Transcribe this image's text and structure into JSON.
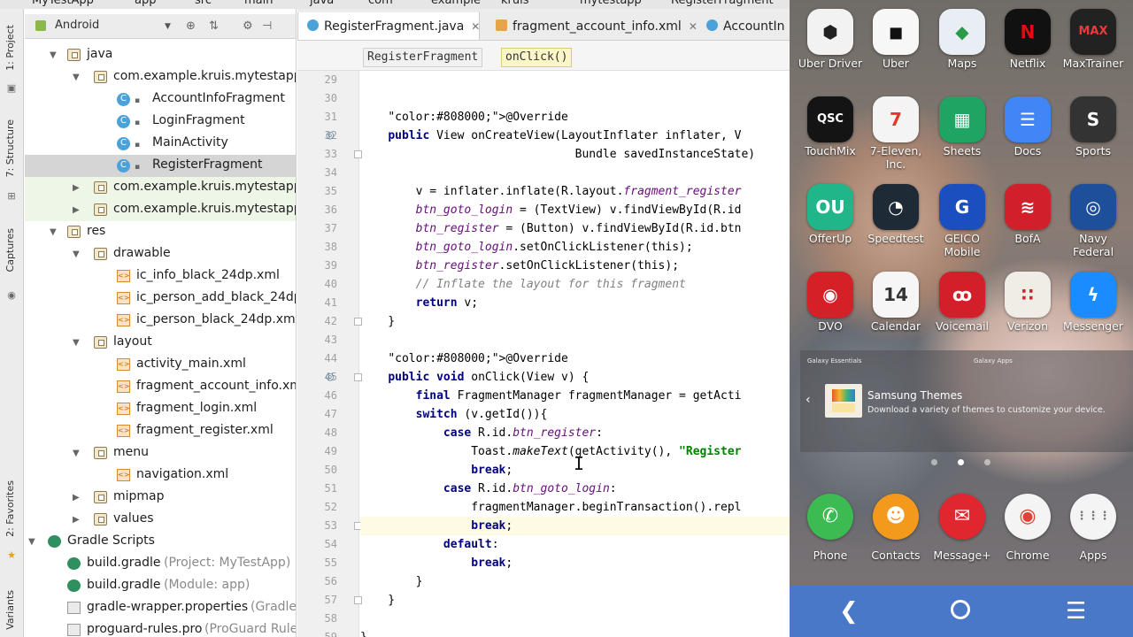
{
  "breadcrumb": [
    "MyTestApp",
    "app",
    "src",
    "main",
    "java",
    "com",
    "example",
    "kruis",
    "mytestapp",
    "RegisterFragment"
  ],
  "tool_strip": {
    "project": "1: Project",
    "structure": "7: Structure",
    "captures": "Captures",
    "favorites": "2: Favorites",
    "variants": "Variants"
  },
  "project_panel": {
    "view_mode": "Android",
    "tree": [
      {
        "label": "java",
        "icon": "folder"
      },
      {
        "label": "com.example.kruis.mytestapp",
        "icon": "package"
      },
      {
        "label": "AccountInfoFragment",
        "icon": "class"
      },
      {
        "label": "LoginFragment",
        "icon": "class"
      },
      {
        "label": "MainActivity",
        "icon": "class"
      },
      {
        "label": "RegisterFragment",
        "icon": "class"
      },
      {
        "label": "com.example.kruis.mytestapp",
        "icon": "package",
        "suffix": "("
      },
      {
        "label": "com.example.kruis.mytestapp",
        "icon": "package",
        "suffix": "(test)"
      },
      {
        "label": "res",
        "icon": "folder"
      },
      {
        "label": "drawable",
        "icon": "folder"
      },
      {
        "label": "ic_info_black_24dp.xml",
        "icon": "xml"
      },
      {
        "label": "ic_person_add_black_24dp.x",
        "icon": "xml"
      },
      {
        "label": "ic_person_black_24dp.xml",
        "icon": "xml"
      },
      {
        "label": "layout",
        "icon": "folder"
      },
      {
        "label": "activity_main.xml",
        "icon": "xml"
      },
      {
        "label": "fragment_account_info.xml",
        "icon": "xml"
      },
      {
        "label": "fragment_login.xml",
        "icon": "xml"
      },
      {
        "label": "fragment_register.xml",
        "icon": "xml"
      },
      {
        "label": "menu",
        "icon": "folder"
      },
      {
        "label": "navigation.xml",
        "icon": "xml"
      },
      {
        "label": "mipmap",
        "icon": "folder"
      },
      {
        "label": "values",
        "icon": "folder"
      },
      {
        "label": "Gradle Scripts",
        "icon": "gradle"
      },
      {
        "label": "build.gradle",
        "icon": "gradle",
        "suffix": "(Project: MyTestApp)"
      },
      {
        "label": "build.gradle",
        "icon": "gradle",
        "suffix": "(Module: app)"
      },
      {
        "label": "gradle-wrapper.properties",
        "icon": "file",
        "suffix": "(Gradle V"
      },
      {
        "label": "proguard-rules.pro",
        "icon": "file",
        "suffix": "(ProGuard Rule"
      }
    ]
  },
  "editor": {
    "tabs": [
      {
        "label": "RegisterFragment.java",
        "active": true
      },
      {
        "label": "fragment_account_info.xml",
        "active": false
      },
      {
        "label": "AccountIn",
        "active": false
      }
    ],
    "breadcrumbs": [
      "RegisterFragment",
      "onClick()"
    ],
    "lines": [
      {
        "n": "29",
        "t": ""
      },
      {
        "n": "30",
        "t": ""
      },
      {
        "n": "31",
        "t": "    @Override"
      },
      {
        "n": "32",
        "t": "    public View onCreateView(LayoutInflater inflater, V"
      },
      {
        "n": "33",
        "t": "                               Bundle savedInstanceState)"
      },
      {
        "n": "34",
        "t": ""
      },
      {
        "n": "35",
        "t": "        v = inflater.inflate(R.layout.fragment_register"
      },
      {
        "n": "36",
        "t": "        btn_goto_login = (TextView) v.findViewById(R.id"
      },
      {
        "n": "37",
        "t": "        btn_register = (Button) v.findViewById(R.id.btn"
      },
      {
        "n": "38",
        "t": "        btn_goto_login.setOnClickListener(this);"
      },
      {
        "n": "39",
        "t": "        btn_register.setOnClickListener(this);"
      },
      {
        "n": "40",
        "t": "        // Inflate the layout for this fragment"
      },
      {
        "n": "41",
        "t": "        return v;"
      },
      {
        "n": "42",
        "t": "    }"
      },
      {
        "n": "43",
        "t": ""
      },
      {
        "n": "44",
        "t": "    @Override"
      },
      {
        "n": "45",
        "t": "    public void onClick(View v) {"
      },
      {
        "n": "46",
        "t": "        final FragmentManager fragmentManager = getActi"
      },
      {
        "n": "47",
        "t": "        switch (v.getId()){"
      },
      {
        "n": "48",
        "t": "            case R.id.btn_register:"
      },
      {
        "n": "49",
        "t": "                Toast.makeText(getActivity(), \"Register"
      },
      {
        "n": "50",
        "t": "                break;"
      },
      {
        "n": "51",
        "t": "            case R.id.btn_goto_login:"
      },
      {
        "n": "52",
        "t": "                fragmentManager.beginTransaction().repl"
      },
      {
        "n": "53",
        "t": "                break;"
      },
      {
        "n": "54",
        "t": "            default:"
      },
      {
        "n": "55",
        "t": "                break;"
      },
      {
        "n": "56",
        "t": "        }"
      },
      {
        "n": "57",
        "t": "    }"
      },
      {
        "n": "58",
        "t": ""
      },
      {
        "n": "59",
        "t": "}"
      }
    ],
    "current_line": "53"
  },
  "phone": {
    "apps": [
      {
        "label": "Uber Driver",
        "icon": "uber-driver-icon",
        "bg": "#f2f2f2",
        "fg": "#222222",
        "glyph": "⬢"
      },
      {
        "label": "Uber",
        "icon": "uber-icon",
        "bg": "#f7f7f7",
        "fg": "#111111",
        "glyph": "◼"
      },
      {
        "label": "Maps",
        "icon": "maps-icon",
        "bg": "#e8eef4",
        "fg": "#2b9a4a",
        "glyph": "◆"
      },
      {
        "label": "Netflix",
        "icon": "netflix-icon",
        "bg": "#111111",
        "fg": "#e50914",
        "glyph": "N"
      },
      {
        "label": "MaxTrainer",
        "icon": "maxtrainer-icon",
        "bg": "#222222",
        "fg": "#e83b3b",
        "glyph": "MAX"
      },
      {
        "label": "TouchMix",
        "icon": "touchmix-icon",
        "bg": "#141414",
        "fg": "#ffffff",
        "glyph": "QSC"
      },
      {
        "label": "7-Eleven,\nInc.",
        "icon": "seven-eleven-icon",
        "bg": "#f4f4f4",
        "fg": "#e2372b",
        "glyph": "7"
      },
      {
        "label": "Sheets",
        "icon": "sheets-icon",
        "bg": "#1fa463",
        "fg": "#ffffff",
        "glyph": "▦"
      },
      {
        "label": "Docs",
        "icon": "docs-icon",
        "bg": "#4285f4",
        "fg": "#ffffff",
        "glyph": "☰"
      },
      {
        "label": "Sports",
        "icon": "sports-icon",
        "bg": "#333333",
        "fg": "#ffffff",
        "glyph": "S"
      },
      {
        "label": "OfferUp",
        "icon": "offerup-icon",
        "bg": "#20b68a",
        "fg": "#ffffff",
        "glyph": "OU"
      },
      {
        "label": "Speedtest",
        "icon": "speedtest-icon",
        "bg": "#1e2a36",
        "fg": "#ffffff",
        "glyph": "◔"
      },
      {
        "label": "GEICO\nMobile",
        "icon": "geico-icon",
        "bg": "#1b4fc0",
        "fg": "#ffffff",
        "glyph": "G"
      },
      {
        "label": "BofA",
        "icon": "bofa-icon",
        "bg": "#d11f2b",
        "fg": "#ffffff",
        "glyph": "≋"
      },
      {
        "label": "Navy\nFederal",
        "icon": "navy-federal-icon",
        "bg": "#1d4f9a",
        "fg": "#ffffff",
        "glyph": "◎"
      },
      {
        "label": "DVO",
        "icon": "dvo-icon",
        "bg": "#d62027",
        "fg": "#ffffff",
        "glyph": "◉"
      },
      {
        "label": "Calendar",
        "icon": "calendar-icon",
        "bg": "#f6f6f6",
        "fg": "#333333",
        "glyph": "14"
      },
      {
        "label": "Voicemail",
        "icon": "voicemail-icon",
        "bg": "#d31f2a",
        "fg": "#ffffff",
        "glyph": "ꝏ"
      },
      {
        "label": "Verizon",
        "icon": "verizon-icon",
        "bg": "#f0ece6",
        "fg": "#d0232e",
        "glyph": "∷"
      },
      {
        "label": "Messenger",
        "icon": "messenger-icon",
        "bg": "#1a8cff",
        "fg": "#ffffff",
        "glyph": "ϟ"
      }
    ],
    "dock": [
      {
        "label": "Phone",
        "icon": "phone-icon",
        "bg": "#3dbb53",
        "fg": "#ffffff",
        "glyph": "✆"
      },
      {
        "label": "Contacts",
        "icon": "contacts-icon",
        "bg": "#f39a1c",
        "fg": "#ffffff",
        "glyph": "☻"
      },
      {
        "label": "Message+",
        "icon": "message-plus-icon",
        "bg": "#e0262e",
        "fg": "#ffffff",
        "glyph": "✉"
      },
      {
        "label": "Chrome",
        "icon": "chrome-icon",
        "bg": "#f4f4f4",
        "fg": "#db4437",
        "glyph": "◉"
      },
      {
        "label": "Apps",
        "icon": "apps-icon",
        "bg": "#f4f4f4",
        "fg": "#777777",
        "glyph": "⋮⋮⋮"
      }
    ],
    "widget": {
      "tag_left": "Galaxy Essentials",
      "tag_right": "Galaxy Apps",
      "title": "Samsung Themes",
      "description": "Download a variety of themes to customize your device."
    },
    "page_dots": 3,
    "active_page": 2
  },
  "colors": {
    "class_icon": "#4aa2d8",
    "annotation": "#808000",
    "keyword": "#000080",
    "string": "#008000",
    "comment": "#808080",
    "field": "#660e7a",
    "navbar": "#4a78c8"
  }
}
